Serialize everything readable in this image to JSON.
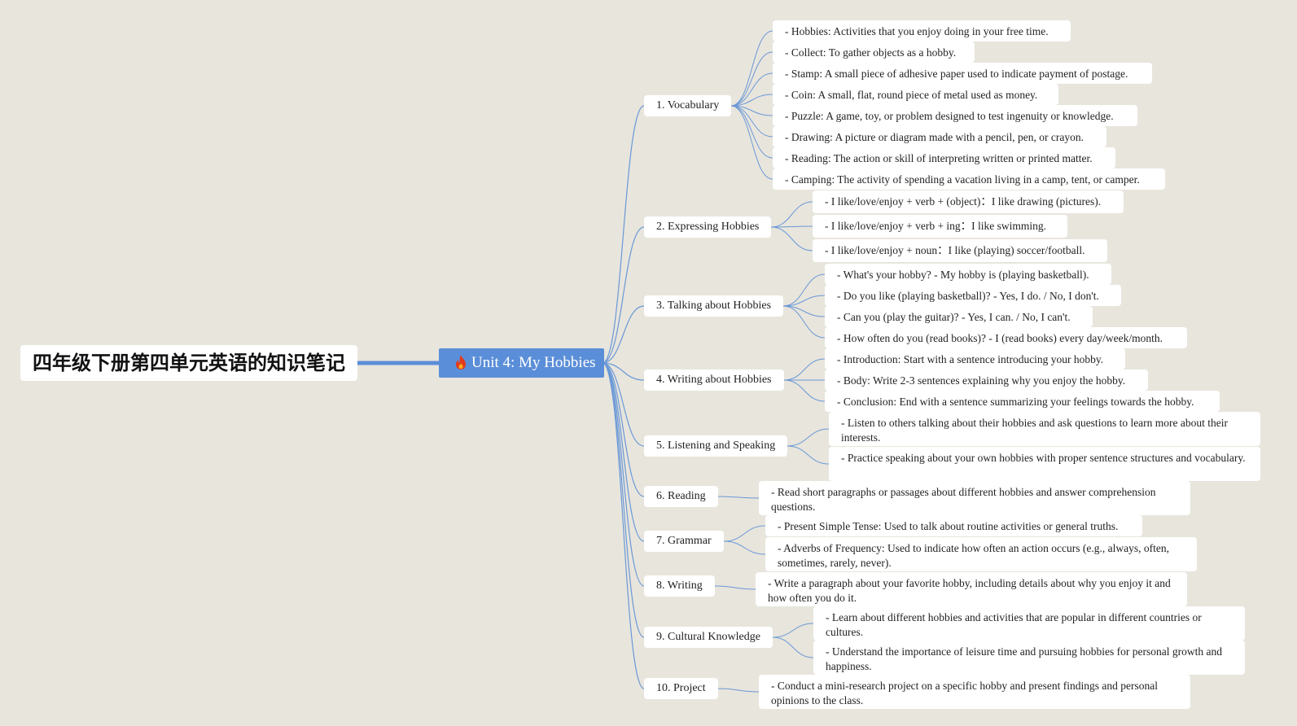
{
  "title": "四年级下册第四单元英语的知识笔记",
  "center": {
    "label": "Unit 4: My Hobbies",
    "icon": "flame-icon"
  },
  "colors": {
    "background": "#e8e5dd",
    "center": "#5b8ed8",
    "line": "#6a98d6",
    "flame": "#e23a1c"
  },
  "branches": [
    {
      "label": "1. Vocabulary",
      "items": [
        "- Hobbies: Activities that you enjoy doing in your free time.",
        "- Collect: To gather objects as a hobby.",
        "- Stamp: A small piece of adhesive paper used to indicate payment of postage.",
        "- Coin: A small, flat, round piece of metal used as money.",
        "- Puzzle: A game, toy, or problem designed to test ingenuity or knowledge.",
        "- Drawing: A picture or diagram made with a pencil, pen, or crayon.",
        "- Reading: The action or skill of interpreting written or printed matter.",
        "- Camping: The activity of spending a vacation living in a camp, tent, or camper."
      ]
    },
    {
      "label": "2. Expressing Hobbies",
      "items": [
        "- I like/love/enjoy + verb + (object)：I like drawing (pictures).",
        "- I like/love/enjoy + verb + ing：I like swimming.",
        "- I like/love/enjoy + noun：I like (playing) soccer/football."
      ]
    },
    {
      "label": "3. Talking about Hobbies",
      "items": [
        "- What's your hobby? - My hobby is (playing basketball).",
        "- Do you like (playing basketball)? - Yes, I do. / No, I don't.",
        "- Can you (play the guitar)? - Yes, I can. / No, I can't.",
        "- How often do you (read books)? - I (read books) every day/week/month."
      ]
    },
    {
      "label": "4. Writing about Hobbies",
      "items": [
        "- Introduction: Start with a sentence introducing your hobby.",
        "- Body: Write 2-3 sentences explaining why you enjoy the hobby.",
        "- Conclusion: End with a sentence summarizing your feelings towards the hobby."
      ]
    },
    {
      "label": "5. Listening and Speaking",
      "items": [
        "- Listen to others talking about their hobbies and ask questions to learn more about their interests.",
        "- Practice speaking about your own hobbies with proper sentence structures and vocabulary."
      ]
    },
    {
      "label": "6. Reading",
      "items": [
        "- Read short paragraphs or passages about different hobbies and answer comprehension questions."
      ]
    },
    {
      "label": "7. Grammar",
      "items": [
        "- Present Simple Tense: Used to talk about routine activities or general truths.",
        "- Adverbs of Frequency: Used to indicate how often an action occurs (e.g., always, often, sometimes, rarely, never)."
      ]
    },
    {
      "label": "8. Writing",
      "items": [
        "- Write a paragraph about your favorite hobby, including details about why you enjoy it and how often you do it."
      ]
    },
    {
      "label": "9. Cultural Knowledge",
      "items": [
        "- Learn about different hobbies and activities that are popular in different countries or cultures.",
        "- Understand the importance of leisure time and pursuing hobbies for personal growth and happiness."
      ]
    },
    {
      "label": "10. Project",
      "items": [
        "- Conduct a mini-research project on a specific hobby and present findings and personal opinions to the class."
      ]
    }
  ]
}
